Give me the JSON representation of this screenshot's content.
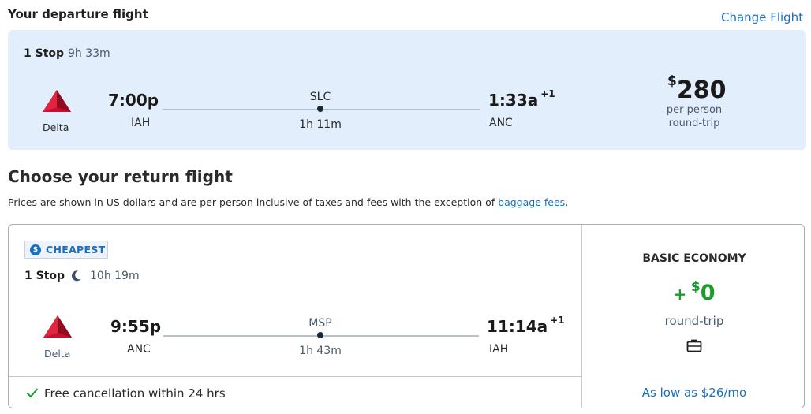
{
  "departure": {
    "heading": "Your departure flight",
    "change_label": "Change Flight",
    "stops": "1 Stop",
    "duration": "9h 33m",
    "airline": "Delta",
    "dep_time": "7:00p",
    "dep_code": "IAH",
    "via": "SLC",
    "layover": "1h 11m",
    "arr_time": "1:33a",
    "arr_plus": "+1",
    "arr_code": "ANC",
    "price_currency": "$",
    "price_amount": "280",
    "price_line1": "per person",
    "price_line2": "round-trip"
  },
  "return": {
    "heading": "Choose your return flight",
    "disclaimer_prefix": "Prices are shown in US dollars and are per person inclusive of taxes and fees with the exception of ",
    "disclaimer_link": "baggage fees",
    "disclaimer_suffix": ".",
    "badge_label": "CHEAPEST",
    "stops": "1 Stop",
    "duration": "10h 19m",
    "airline": "Delta",
    "dep_time": "9:55p",
    "dep_code": "ANC",
    "via": "MSP",
    "layover": "1h 43m",
    "arr_time": "11:14a",
    "arr_plus": "+1",
    "arr_code": "IAH",
    "cancellation": "Free cancellation within 24 hrs",
    "fare_class": "BASIC ECONOMY",
    "fare_plus": "+",
    "fare_currency": "$",
    "fare_amount": "0",
    "fare_rt": "round-trip",
    "monthly": "As low as $26/mo"
  },
  "icons": {
    "airline_logo": "delta-logo-icon",
    "badge": "dollar-badge-icon",
    "night": "moon-icon",
    "bag": "briefcase-icon",
    "check": "check-icon"
  },
  "colors": {
    "link": "#1a6fbf",
    "card_bg": "#e3eefc",
    "accent_green": "#1a9e2a",
    "delta_red": "#c8102e"
  }
}
